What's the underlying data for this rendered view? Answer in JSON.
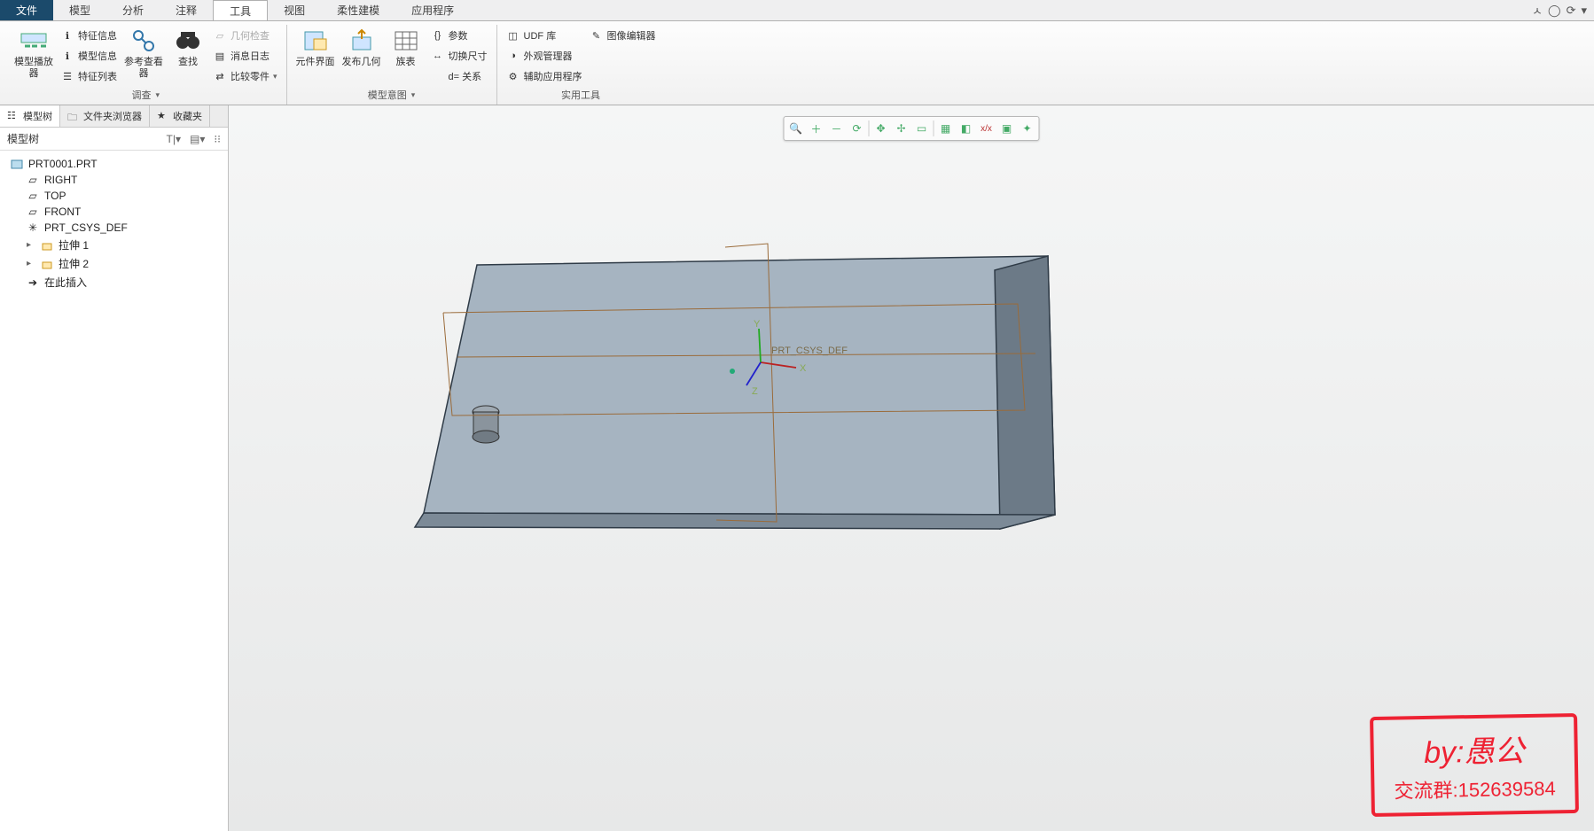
{
  "menu": {
    "tabs": [
      "文件",
      "模型",
      "分析",
      "注释",
      "工具",
      "视图",
      "柔性建模",
      "应用程序"
    ],
    "active": 4
  },
  "titlebar_icons": [
    "minimize",
    "help",
    "settings",
    "close"
  ],
  "ribbon": {
    "groups": [
      {
        "label": "调查",
        "dd": true,
        "big": [
          {
            "icon": "player",
            "label": "模型播放\n器"
          }
        ],
        "stacks": [
          [
            {
              "icon": "info",
              "label": "特征信息"
            },
            {
              "icon": "info2",
              "label": "模型信息"
            },
            {
              "icon": "list",
              "label": "特征列表"
            }
          ]
        ],
        "big2": [
          {
            "icon": "chain",
            "label": "参考查看\n器"
          },
          {
            "icon": "binoc",
            "label": "查找"
          }
        ],
        "stacks2": [
          [
            {
              "icon": "geom",
              "label": "几何检查",
              "disabled": true
            },
            {
              "icon": "log",
              "label": "消息日志"
            },
            {
              "icon": "compare",
              "label": "比较零件",
              "dd": true
            }
          ]
        ]
      },
      {
        "label": "模型意图",
        "dd": true,
        "big": [
          {
            "icon": "comp",
            "label": "元件界面"
          },
          {
            "icon": "publish",
            "label": "发布几何"
          },
          {
            "icon": "table",
            "label": "族表"
          }
        ],
        "stacks": [
          [
            {
              "icon": "param",
              "label": "参数"
            },
            {
              "icon": "switch",
              "label": "切换尺寸"
            },
            {
              "icon": "rel",
              "label": "d= 关系"
            }
          ]
        ]
      },
      {
        "label": "实用工具",
        "stacks": [
          [
            {
              "icon": "udf",
              "label": "UDF 库"
            },
            {
              "icon": "appear",
              "label": "外观管理器"
            },
            {
              "icon": "aux",
              "label": "辅助应用程序"
            }
          ],
          [
            {
              "icon": "imged",
              "label": "图像编辑器"
            }
          ]
        ]
      }
    ]
  },
  "leftPanel": {
    "tabs": [
      {
        "icon": "tree",
        "label": "模型树"
      },
      {
        "icon": "folder",
        "label": "文件夹浏览器"
      },
      {
        "icon": "fav",
        "label": "收藏夹"
      }
    ],
    "activeTab": 0,
    "title": "模型树",
    "tree": {
      "root": "PRT0001.PRT",
      "items": [
        {
          "icon": "plane",
          "label": "RIGHT"
        },
        {
          "icon": "plane",
          "label": "TOP"
        },
        {
          "icon": "plane",
          "label": "FRONT"
        },
        {
          "icon": "csys",
          "label": "PRT_CSYS_DEF"
        },
        {
          "icon": "extrude",
          "label": "拉伸 1",
          "exp": "▸"
        },
        {
          "icon": "extrude",
          "label": "拉伸 2",
          "exp": "▸"
        },
        {
          "icon": "insert",
          "label": "在此插入"
        }
      ]
    }
  },
  "viewToolbar": [
    "zoom-fit",
    "zoom-in",
    "zoom-out",
    "repaint",
    "|",
    "spin",
    "pan",
    "named-views",
    "|",
    "saved-orient",
    "display-style",
    "xy",
    "perspective",
    "render"
  ],
  "model3d": {
    "csys_label": "PRT_CSYS_DEF",
    "axes": {
      "x": "X",
      "y": "Y",
      "z": "Z"
    }
  },
  "watermark": {
    "line1": "by:愚公",
    "line2": "交流群:152639584"
  }
}
